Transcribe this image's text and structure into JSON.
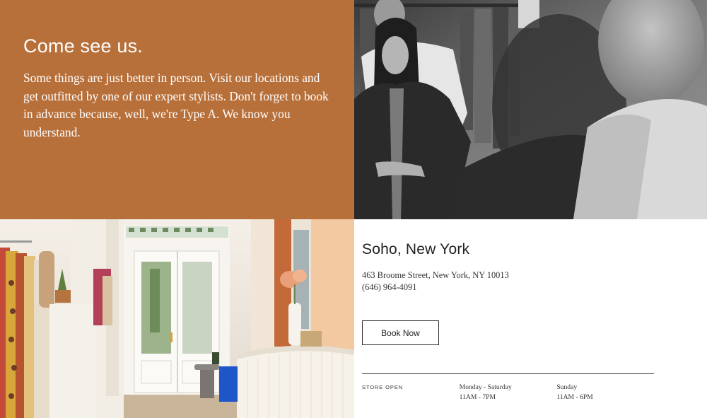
{
  "intro": {
    "heading": "Come see us.",
    "body": "Some things are just better in person. Visit our locations and get outfitted by one of our expert stylists. Don't forget to book in advance because, well, we're Type A. We know you understand.",
    "background": "#b8703a"
  },
  "store": {
    "name": "Soho, New York",
    "address": "463 Broome Street, New York, NY 10013",
    "phone": "(646) 964-4091",
    "book_label": "Book Now",
    "hours_label": "STORE OPEN",
    "hours": [
      {
        "days": "Monday - Saturday",
        "time": "11AM - 7PM"
      },
      {
        "days": "Sunday",
        "time": "11AM - 6PM"
      }
    ]
  },
  "images": {
    "top": "black-and-white photo of a stylist fitting a customer in a jacket",
    "bottom": "interior of the boutique with clothing racks, counter and glass doors"
  }
}
